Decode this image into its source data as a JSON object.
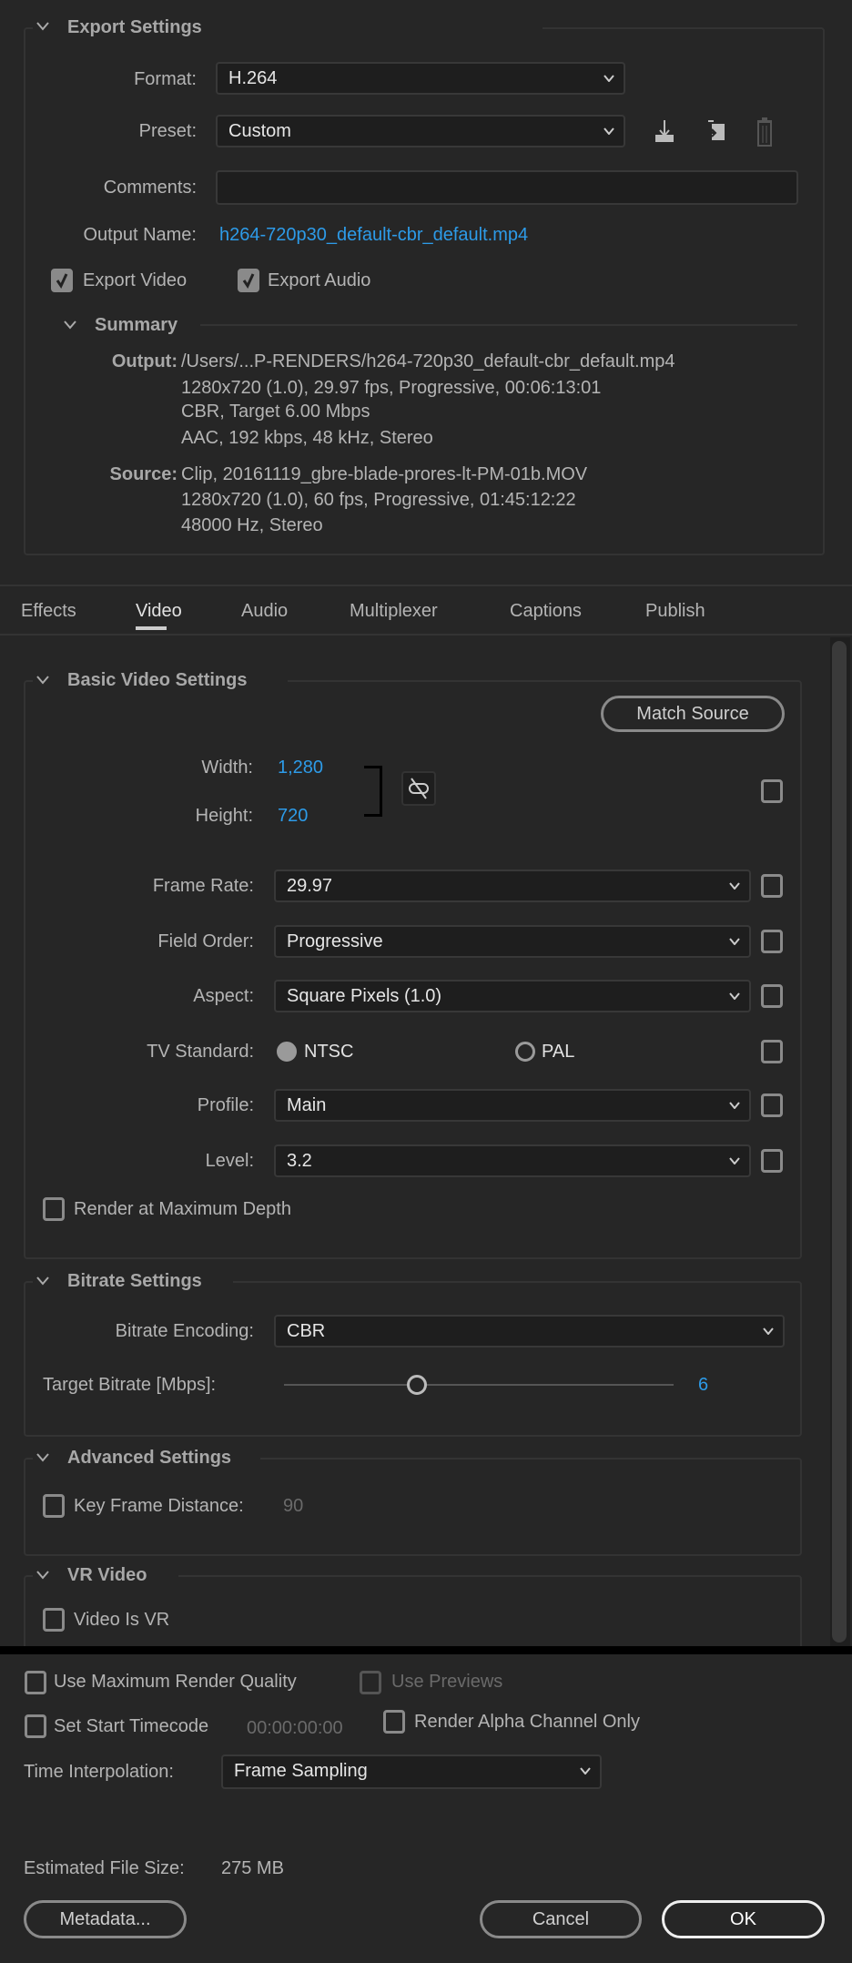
{
  "export_settings": {
    "title": "Export Settings",
    "format_label": "Format:",
    "format_value": "H.264",
    "preset_label": "Preset:",
    "preset_value": "Custom",
    "preset_icons": [
      "save-preset-icon",
      "import-preset-icon",
      "delete-preset-icon"
    ],
    "comments_label": "Comments:",
    "comments_value": "",
    "output_name_label": "Output Name:",
    "output_name_value": "h264-720p30_default-cbr_default.mp4",
    "export_video": {
      "label": "Export Video",
      "checked": true
    },
    "export_audio": {
      "label": "Export Audio",
      "checked": true
    },
    "summary": {
      "title": "Summary",
      "output_label": "Output:",
      "output_lines": [
        "/Users/...P-RENDERS/h264-720p30_default-cbr_default.mp4",
        "1280x720 (1.0), 29.97 fps, Progressive, 00:06:13:01",
        "CBR, Target 6.00 Mbps",
        "AAC, 192 kbps, 48 kHz, Stereo"
      ],
      "source_label": "Source:",
      "source_lines": [
        "Clip, 20161119_gbre-blade-prores-lt-PM-01b.MOV",
        "1280x720 (1.0), 60 fps, Progressive, 01:45:12:22",
        "48000 Hz, Stereo"
      ]
    }
  },
  "tabs": [
    {
      "label": "Effects"
    },
    {
      "label": "Video",
      "active": true
    },
    {
      "label": "Audio"
    },
    {
      "label": "Multiplexer"
    },
    {
      "label": "Captions"
    },
    {
      "label": "Publish"
    }
  ],
  "basic_video": {
    "title": "Basic Video Settings",
    "match_source": "Match Source",
    "width_label": "Width:",
    "width_value": "1,280",
    "height_label": "Height:",
    "height_value": "720",
    "frame_rate_label": "Frame Rate:",
    "frame_rate_value": "29.97",
    "field_order_label": "Field Order:",
    "field_order_value": "Progressive",
    "aspect_label": "Aspect:",
    "aspect_value": "Square Pixels (1.0)",
    "tv_standard_label": "TV Standard:",
    "tv_ntsc": "NTSC",
    "tv_pal": "PAL",
    "tv_selected": "NTSC",
    "profile_label": "Profile:",
    "profile_value": "Main",
    "level_label": "Level:",
    "level_value": "3.2",
    "render_max_depth": "Render at Maximum Depth"
  },
  "bitrate": {
    "title": "Bitrate Settings",
    "encoding_label": "Bitrate Encoding:",
    "encoding_value": "CBR",
    "target_label": "Target Bitrate [Mbps]:",
    "target_value": "6",
    "slider_fraction": 0.34
  },
  "advanced": {
    "title": "Advanced Settings",
    "key_frame_label": "Key Frame Distance:",
    "key_frame_value": "90"
  },
  "vr": {
    "title": "VR Video",
    "video_is_vr": "Video Is VR"
  },
  "bottom": {
    "max_render_quality": "Use Maximum Render Quality",
    "use_previews": "Use Previews",
    "set_start_timecode": "Set Start Timecode",
    "timecode_value": "00:00:00:00",
    "render_alpha": "Render Alpha Channel Only",
    "time_interp_label": "Time Interpolation:",
    "time_interp_value": "Frame Sampling",
    "est_size_label": "Estimated File Size:",
    "est_size_value": "275 MB",
    "metadata": "Metadata...",
    "cancel": "Cancel",
    "ok": "OK"
  },
  "colors": {
    "background": "#262626",
    "accent": "#2d9be8"
  }
}
